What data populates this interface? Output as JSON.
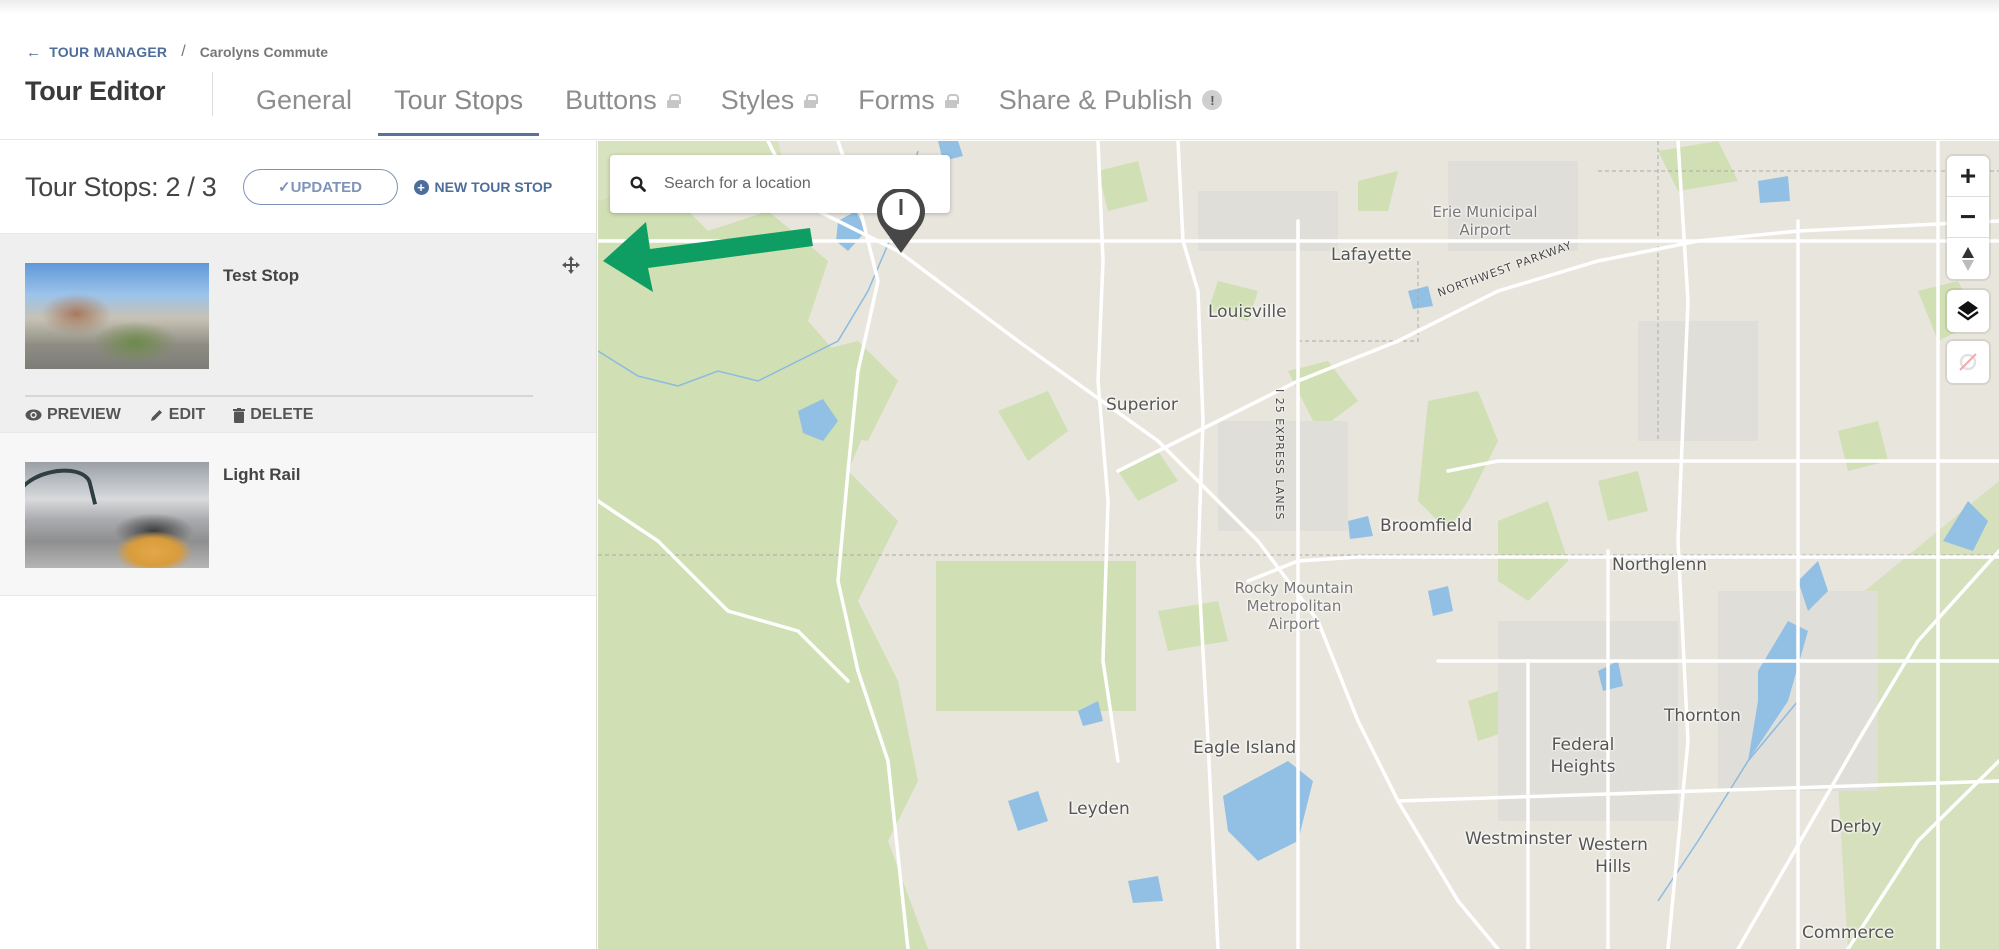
{
  "breadcrumb": {
    "back_label": "TOUR MANAGER",
    "separator": "/",
    "current": "Carolyns Commute"
  },
  "header": {
    "title": "Tour Editor",
    "tabs": [
      {
        "label": "General",
        "locked": false,
        "active": false
      },
      {
        "label": "Tour Stops",
        "locked": false,
        "active": true
      },
      {
        "label": "Buttons",
        "locked": true,
        "active": false
      },
      {
        "label": "Styles",
        "locked": true,
        "active": false
      },
      {
        "label": "Forms",
        "locked": true,
        "active": false
      },
      {
        "label": "Share & Publish",
        "locked": false,
        "active": false,
        "badge": "!"
      }
    ]
  },
  "panel": {
    "count_label": "Tour Stops: 2 / 3",
    "updated_label": "✓UPDATED",
    "new_stop_label": "NEW TOUR STOP",
    "stops": [
      {
        "name": "Test Stop",
        "selected": true,
        "actions": [
          "PREVIEW",
          "EDIT",
          "DELETE"
        ]
      },
      {
        "name": "Light Rail",
        "selected": false
      }
    ]
  },
  "map": {
    "search_placeholder": "Search for a location",
    "pin_label": "1",
    "controls": {
      "zoom_in": "+",
      "zoom_out": "−",
      "compass": "compass-icon",
      "layers": "layers-icon",
      "geolocate": "geolocate-disabled-icon"
    },
    "places": [
      {
        "name": "Lafayette"
      },
      {
        "name": "Louisville"
      },
      {
        "name": "Superior"
      },
      {
        "name": "Broomfield"
      },
      {
        "name": "Northglenn"
      },
      {
        "name": "Thornton"
      },
      {
        "name": "Federal Heights"
      },
      {
        "name": "Westminster"
      },
      {
        "name": "Western Hills"
      },
      {
        "name": "Derby"
      },
      {
        "name": "Commerce"
      },
      {
        "name": "Eagle Island"
      },
      {
        "name": "Leyden"
      }
    ],
    "pois": [
      {
        "name": "Erie Municipal Airport"
      },
      {
        "name": "Rocky Mountain Metropolitan Airport"
      }
    ],
    "roads": [
      {
        "name": "NORTHWEST PARKWAY"
      },
      {
        "name": "I 25 EXPRESS LANES"
      }
    ],
    "annotation_color": "#0e9e63"
  }
}
